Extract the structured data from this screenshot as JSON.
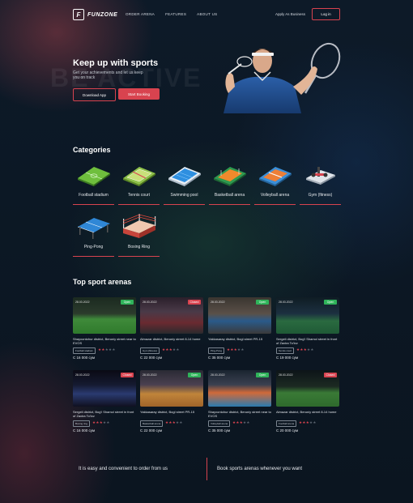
{
  "brand": {
    "name": "FUNZONE",
    "mark": "F"
  },
  "nav": [
    "ORDER ARENA",
    "FEATURES",
    "ABOUT US"
  ],
  "header": {
    "apply": "Apply As Business",
    "login": "Log in"
  },
  "hero": {
    "bg_text": "BE ACTIVE",
    "title": "Keep up with sports",
    "subtitle": "Get your achievements and let us keep you on track",
    "download": "Download App",
    "start": "Start Booking"
  },
  "categories_title": "Categories",
  "categories": [
    {
      "label": "Football stadium",
      "icon": "football-field-icon"
    },
    {
      "label": "Tennis court",
      "icon": "tennis-court-icon"
    },
    {
      "label": "Swimming pool",
      "icon": "swimming-pool-icon"
    },
    {
      "label": "Basketball arena",
      "icon": "basketball-court-icon"
    },
    {
      "label": "Volleyball arena",
      "icon": "volleyball-court-icon"
    },
    {
      "label": "Gym (fitness)",
      "icon": "gym-icon"
    },
    {
      "label": "Ping-Pong",
      "icon": "ping-pong-table-icon"
    },
    {
      "label": "Boxing Ring",
      "icon": "boxing-ring-icon"
    }
  ],
  "arenas_title": "Top sport arenas",
  "arenas": [
    {
      "date": "28.03.2022",
      "status": "Open",
      "address": "Shayxontohur district, Beruniy street near to EVOS",
      "tag": "Football stadium",
      "stars": 2,
      "price": "C 16 000 сум",
      "scene": "football"
    },
    {
      "date": "28.03.2022",
      "status": "Closed",
      "address": "Almazar district, Beruniy street 8-14 home",
      "tag": "Gym (fitness)",
      "stars": 3,
      "price": "C 22 000 сум",
      "scene": "gym"
    },
    {
      "date": "28.03.2022",
      "status": "Open",
      "address": "Yakkasaray district, Bogl street PR-15",
      "tag": "Ping-Pong",
      "stars": 3,
      "price": "C 35 000 сум",
      "scene": "pingpong"
    },
    {
      "date": "28.03.2022",
      "status": "Open",
      "address": "Sergeli district, Bog'i Shamol street in front of Zaxira To'lov",
      "tag": "Tennis court",
      "stars": 3,
      "price": "C 19 000 сум",
      "scene": "tennis"
    },
    {
      "date": "28.03.2022",
      "status": "Closed",
      "address": "Sergeli district, Bog'i Shamol street in front of Zaxira To'lov",
      "tag": "Boxing ring",
      "stars": 3,
      "price": "C 16 000 сум",
      "scene": "boxing"
    },
    {
      "date": "28.03.2022",
      "status": "Open",
      "address": "Yakkasaray district, Bogl street PR-15",
      "tag": "Basketball arena",
      "stars": 3,
      "price": "C 22 000 сум",
      "scene": "basketball"
    },
    {
      "date": "28.03.2022",
      "status": "Open",
      "address": "Shayxontohur district, Beruniy street near to EVOS",
      "tag": "Volleyball arena",
      "stars": 3,
      "price": "C 35 000 сум",
      "scene": "volleyball"
    },
    {
      "date": "28.03.2022",
      "status": "Closed",
      "address": "Almazar district, Beruniy street 8-14 home",
      "tag": "Football arena",
      "stars": 3,
      "price": "C 20 000 сум",
      "scene": "football2"
    }
  ],
  "footer": {
    "left": "It is easy and convenient to order from us",
    "right": "Book sports arenas whenever you want"
  },
  "colors": {
    "accent": "#d8434f",
    "open": "#2fb35a",
    "closed": "#d8434f",
    "star_on": "#d8434f",
    "star_off": "#5b6570"
  }
}
